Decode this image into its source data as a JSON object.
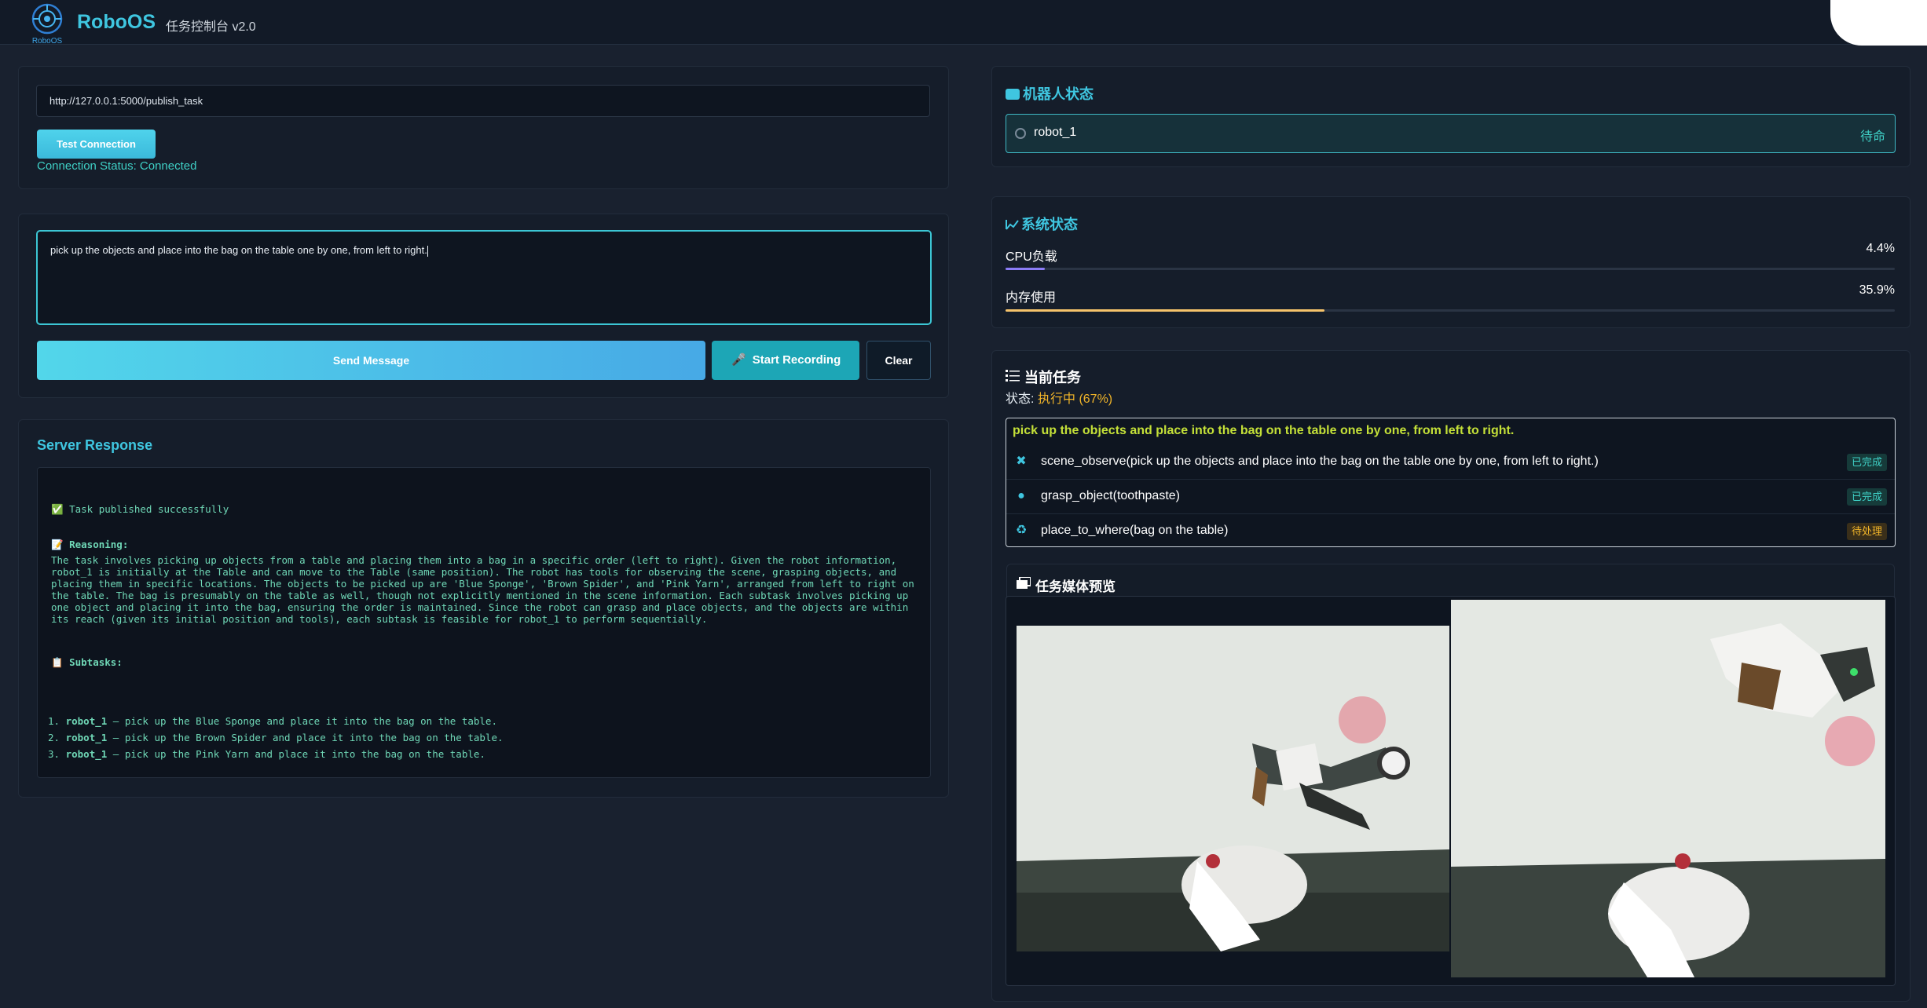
{
  "header": {
    "brand": "RoboOS",
    "logo_text": "RoboOS",
    "subtitle": "任务控制台 v2.0"
  },
  "connection": {
    "url_value": "http://127.0.0.1:5000/publish_task",
    "test_button": "Test Connection",
    "status": "Connection Status: Connected"
  },
  "message": {
    "text": "pick up the objects and place into the bag on the table one by one, from left to right.",
    "send_button": "Send Message",
    "record_button": "Start Recording",
    "clear_button": "Clear"
  },
  "response": {
    "title": "Server Response",
    "success": "✅ Task published successfully",
    "reasoning_label": "📝 Reasoning:",
    "reasoning_text": "The task involves picking up objects from a table and placing them into a bag in a specific order (left to right). Given the robot information, robot_1 is initially at the Table and can move to the Table (same position). The robot has tools for observing the scene, grasping objects, and placing them in specific locations. The objects to be picked up are 'Blue Sponge', 'Brown Spider', and 'Pink Yarn', arranged from left to right on the table. The bag is presumably on the table as well, though not explicitly mentioned in the scene information. Each subtask involves picking up one object and placing it into the bag, ensuring the order is maintained. Since the robot can grasp and place objects, and the objects are within its reach (given its initial position and tools), each subtask is feasible for robot_1 to perform sequentially.",
    "subtasks_label": "📋 Subtasks:",
    "subtasks": [
      {
        "num": "1.",
        "robot": "robot_1",
        "text": " – pick up the Blue Sponge and place it into the bag on the table."
      },
      {
        "num": "2.",
        "robot": "robot_1",
        "text": " – pick up the Brown Spider and place it into the bag on the table."
      },
      {
        "num": "3.",
        "robot": "robot_1",
        "text": " – pick up the Pink Yarn and place it into the bag on the table."
      }
    ]
  },
  "robot_status": {
    "title": "机器人状态",
    "robot_name": "robot_1",
    "state": "待命"
  },
  "system_status": {
    "title": "系统状态",
    "cpu_label": "CPU负载",
    "cpu_value": "4.4%",
    "cpu_fraction": 0.044,
    "mem_label": "内存使用",
    "mem_value": "35.9%",
    "mem_fraction": 0.359,
    "cpu_color": "#8b7cf6",
    "mem_color": "#f6c36b"
  },
  "current_task": {
    "title": "当前任务",
    "status_label": "状态: ",
    "status_value": "执行中 (67%)",
    "headline": "pick up the objects and place into the bag on the table one by one, from left to right.",
    "steps": [
      {
        "icon": "tools-icon",
        "text": "scene_observe(pick up the objects and place into the bag on the table one by one, from left to right.)",
        "badge": "已完成",
        "state": "done"
      },
      {
        "icon": "hand-icon",
        "text": "grasp_object(toothpaste)",
        "badge": "已完成",
        "state": "done"
      },
      {
        "icon": "recycle-icon",
        "text": "place_to_where(bag on the table)",
        "badge": "待处理",
        "state": "pending"
      }
    ]
  },
  "media": {
    "title": "任务媒体预览"
  }
}
